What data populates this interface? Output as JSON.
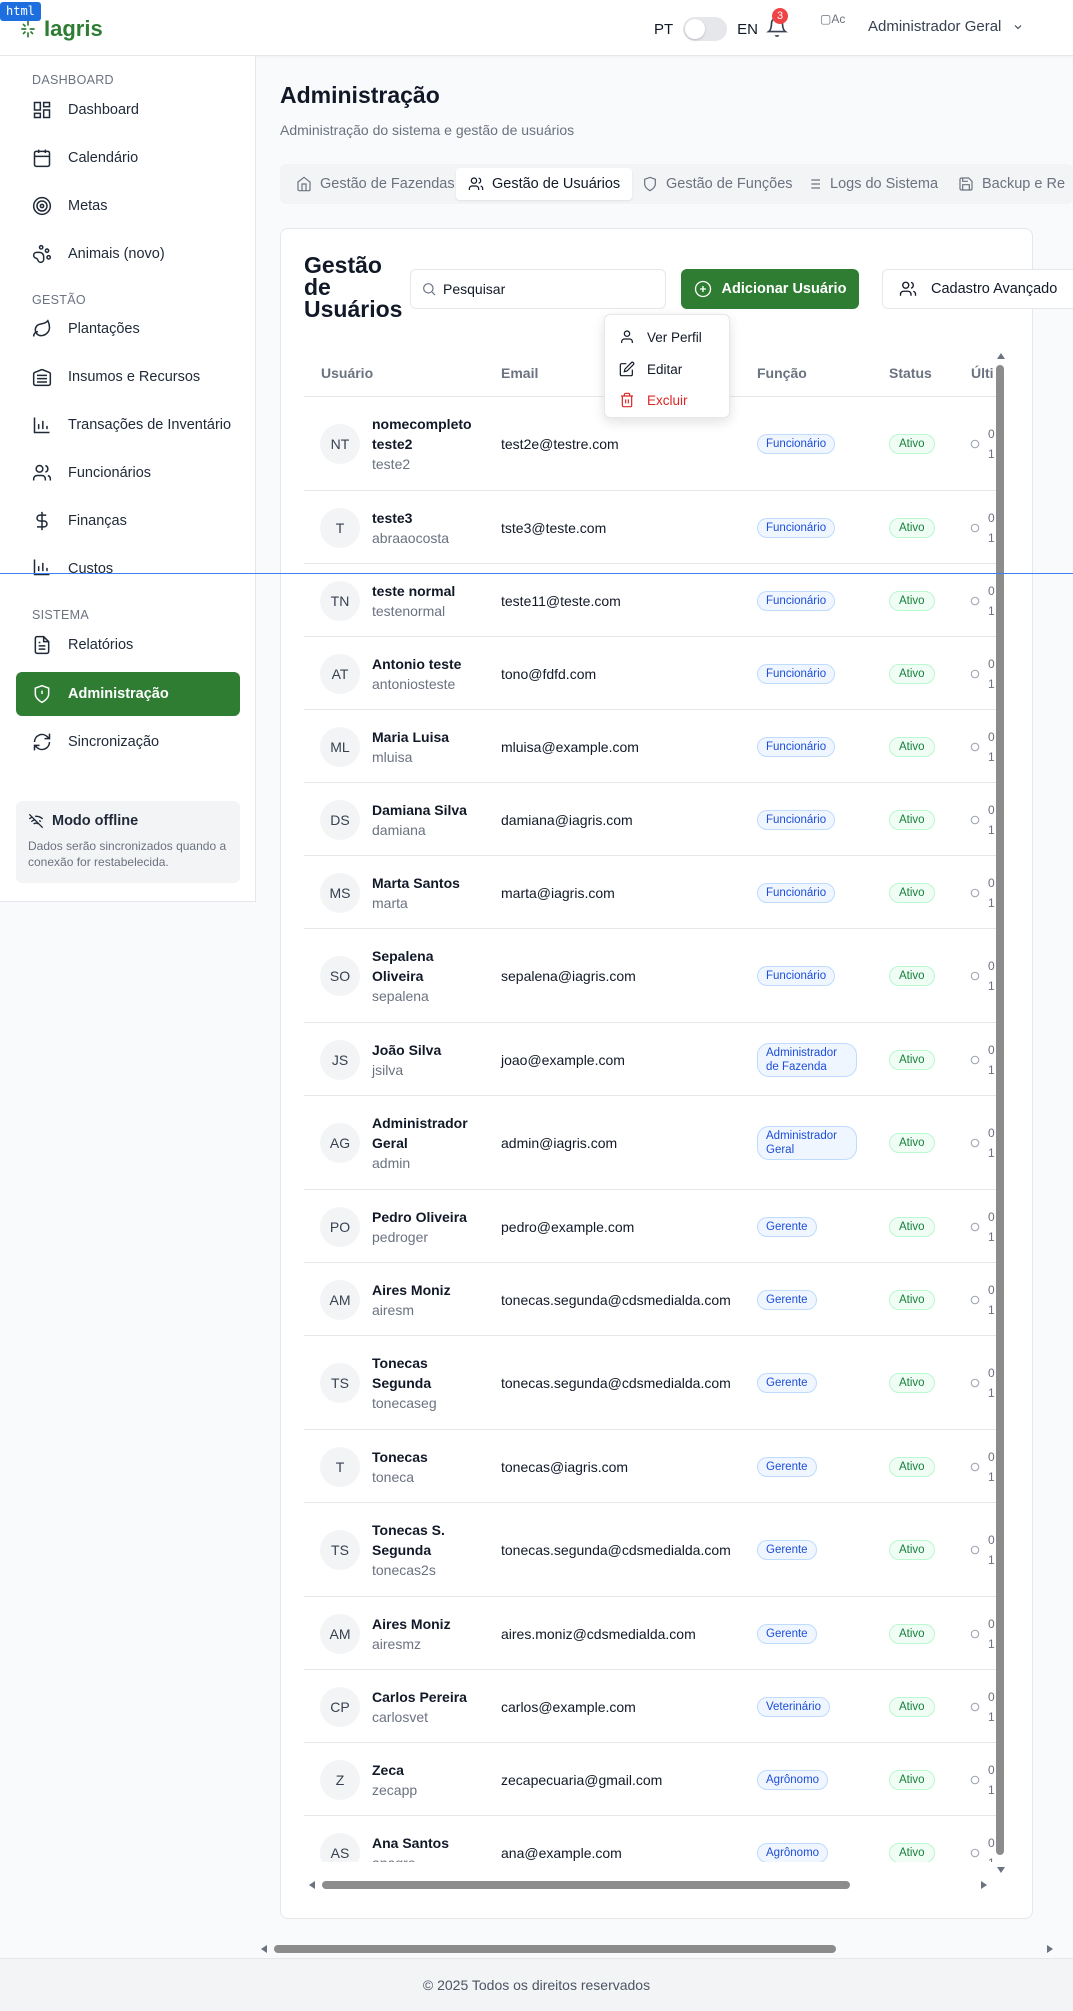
{
  "overlay": {
    "tag": "html"
  },
  "header": {
    "logo": "Iagris",
    "lang_pt": "PT",
    "lang_en": "EN",
    "notification_count": "3",
    "avatar_alt": "Ac",
    "user_name": "Administrador Geral"
  },
  "sidebar": {
    "sections": [
      {
        "title": "DASHBOARD",
        "items": [
          {
            "label": "Dashboard",
            "icon": "dashboard-icon"
          },
          {
            "label": "Calendário",
            "icon": "calendar-icon"
          },
          {
            "label": "Metas",
            "icon": "target-icon"
          },
          {
            "label": "Animais (novo)",
            "icon": "paw-icon"
          }
        ]
      },
      {
        "title": "GESTÃO",
        "items": [
          {
            "label": "Plantações",
            "icon": "leaf-icon"
          },
          {
            "label": "Insumos e Recursos",
            "icon": "warehouse-icon"
          },
          {
            "label": "Transações de Inventário",
            "icon": "bar-chart-icon"
          },
          {
            "label": "Funcionários",
            "icon": "users-icon"
          },
          {
            "label": "Finanças",
            "icon": "dollar-icon"
          },
          {
            "label": "Custos",
            "icon": "bar-chart-icon"
          }
        ]
      },
      {
        "title": "SISTEMA",
        "items": [
          {
            "label": "Relatórios",
            "icon": "file-text-icon"
          },
          {
            "label": "Administração",
            "icon": "shield-icon",
            "active": true
          },
          {
            "label": "Sincronização",
            "icon": "refresh-icon"
          }
        ]
      }
    ],
    "offline": {
      "title": "Modo offline",
      "text": "Dados serão sincronizados quando a conexão for restabelecida."
    }
  },
  "main": {
    "title": "Administração",
    "subtitle": "Administração do sistema e gestão de usuários",
    "tabs": [
      {
        "label": "Gestão de Fazendas",
        "icon": "home-icon"
      },
      {
        "label": "Gestão de Usuários",
        "icon": "users-icon",
        "active": true
      },
      {
        "label": "Gestão de Funções",
        "icon": "shield-icon"
      },
      {
        "label": "Logs do Sistema",
        "icon": "list-icon"
      },
      {
        "label": "Backup e Re",
        "icon": "save-icon"
      }
    ],
    "card_title": "Gestão de Usuários",
    "search_placeholder": "Pesquisar",
    "add_button": "Adicionar Usuário",
    "advanced_button": "Cadastro Avançado",
    "context_menu": {
      "view": "Ver Perfil",
      "edit": "Editar",
      "delete": "Excluir"
    },
    "columns": [
      "Usuário",
      "Email",
      "Função",
      "Status",
      "Últi"
    ],
    "users": [
      {
        "initials": "NT",
        "name": "nomecompleto teste2",
        "login": "teste2",
        "email": "test2e@testre.com",
        "role": "Funcionário",
        "status": "Ativo",
        "last": [
          "0",
          "1"
        ]
      },
      {
        "initials": "T",
        "name": "teste3",
        "login": "abraaocosta",
        "email": "tste3@teste.com",
        "role": "Funcionário",
        "status": "Ativo",
        "last": [
          "0",
          "1"
        ]
      },
      {
        "initials": "TN",
        "name": "teste normal",
        "login": "testenormal",
        "email": "teste11@teste.com",
        "role": "Funcionário",
        "status": "Ativo",
        "last": [
          "0",
          "1"
        ]
      },
      {
        "initials": "AT",
        "name": "Antonio teste",
        "login": "antoniosteste",
        "email": "tono@fdfd.com",
        "role": "Funcionário",
        "status": "Ativo",
        "last": [
          "0",
          "1"
        ]
      },
      {
        "initials": "ML",
        "name": "Maria Luisa",
        "login": "mluisa",
        "email": "mluisa@example.com",
        "role": "Funcionário",
        "status": "Ativo",
        "last": [
          "0",
          "1"
        ]
      },
      {
        "initials": "DS",
        "name": "Damiana Silva",
        "login": "damiana",
        "email": "damiana@iagris.com",
        "role": "Funcionário",
        "status": "Ativo",
        "last": [
          "0",
          "1"
        ]
      },
      {
        "initials": "MS",
        "name": "Marta Santos",
        "login": "marta",
        "email": "marta@iagris.com",
        "role": "Funcionário",
        "status": "Ativo",
        "last": [
          "0",
          "1"
        ]
      },
      {
        "initials": "SO",
        "name": "Sepalena Oliveira",
        "login": "sepalena",
        "email": "sepalena@iagris.com",
        "role": "Funcionário",
        "status": "Ativo",
        "last": [
          "0",
          "1"
        ]
      },
      {
        "initials": "JS",
        "name": "João Silva",
        "login": "jsilva",
        "email": "joao@example.com",
        "role": "Administrador de Fazenda",
        "status": "Ativo",
        "last": [
          "0",
          "1"
        ]
      },
      {
        "initials": "AG",
        "name": "Administrador Geral",
        "login": "admin",
        "email": "admin@iagris.com",
        "role": "Administrador Geral",
        "status": "Ativo",
        "last": [
          "0",
          "1"
        ]
      },
      {
        "initials": "PO",
        "name": "Pedro Oliveira",
        "login": "pedroger",
        "email": "pedro@example.com",
        "role": "Gerente",
        "status": "Ativo",
        "last": [
          "0",
          "1"
        ]
      },
      {
        "initials": "AM",
        "name": "Aires Moniz",
        "login": "airesm",
        "email": "tonecas.segunda@cdsmedialda.com",
        "role": "Gerente",
        "status": "Ativo",
        "last": [
          "0",
          "1"
        ]
      },
      {
        "initials": "TS",
        "name": "Tonecas Segunda",
        "login": "tonecaseg",
        "email": "tonecas.segunda@cdsmedialda.com",
        "role": "Gerente",
        "status": "Ativo",
        "last": [
          "0",
          "1"
        ]
      },
      {
        "initials": "T",
        "name": "Tonecas",
        "login": "toneca",
        "email": "tonecas@iagris.com",
        "role": "Gerente",
        "status": "Ativo",
        "last": [
          "0",
          "1"
        ]
      },
      {
        "initials": "TS",
        "name": "Tonecas S. Segunda",
        "login": "tonecas2s",
        "email": "tonecas.segunda@cdsmedialda.com",
        "role": "Gerente",
        "status": "Ativo",
        "last": [
          "0",
          "1"
        ]
      },
      {
        "initials": "AM",
        "name": "Aires Moniz",
        "login": "airesmz",
        "email": "aires.moniz@cdsmedialda.com",
        "role": "Gerente",
        "status": "Ativo",
        "last": [
          "0",
          "1"
        ]
      },
      {
        "initials": "CP",
        "name": "Carlos Pereira",
        "login": "carlosvet",
        "email": "carlos@example.com",
        "role": "Veterinário",
        "status": "Ativo",
        "last": [
          "0",
          "1"
        ]
      },
      {
        "initials": "Z",
        "name": "Zeca",
        "login": "zecapp",
        "email": "zecapecuaria@gmail.com",
        "role": "Agrônomo",
        "status": "Ativo",
        "last": [
          "0",
          "1"
        ]
      },
      {
        "initials": "AS",
        "name": "Ana Santos",
        "login": "anagro",
        "email": "ana@example.com",
        "role": "Agrônomo",
        "status": "Ativo",
        "last": [
          "0",
          "1"
        ]
      }
    ]
  },
  "footer": {
    "text": "© 2025 Todos os direitos reservados"
  },
  "colors": {
    "brand": "#2e7d32",
    "danger": "#dc2626",
    "badge": "#ef4444"
  }
}
